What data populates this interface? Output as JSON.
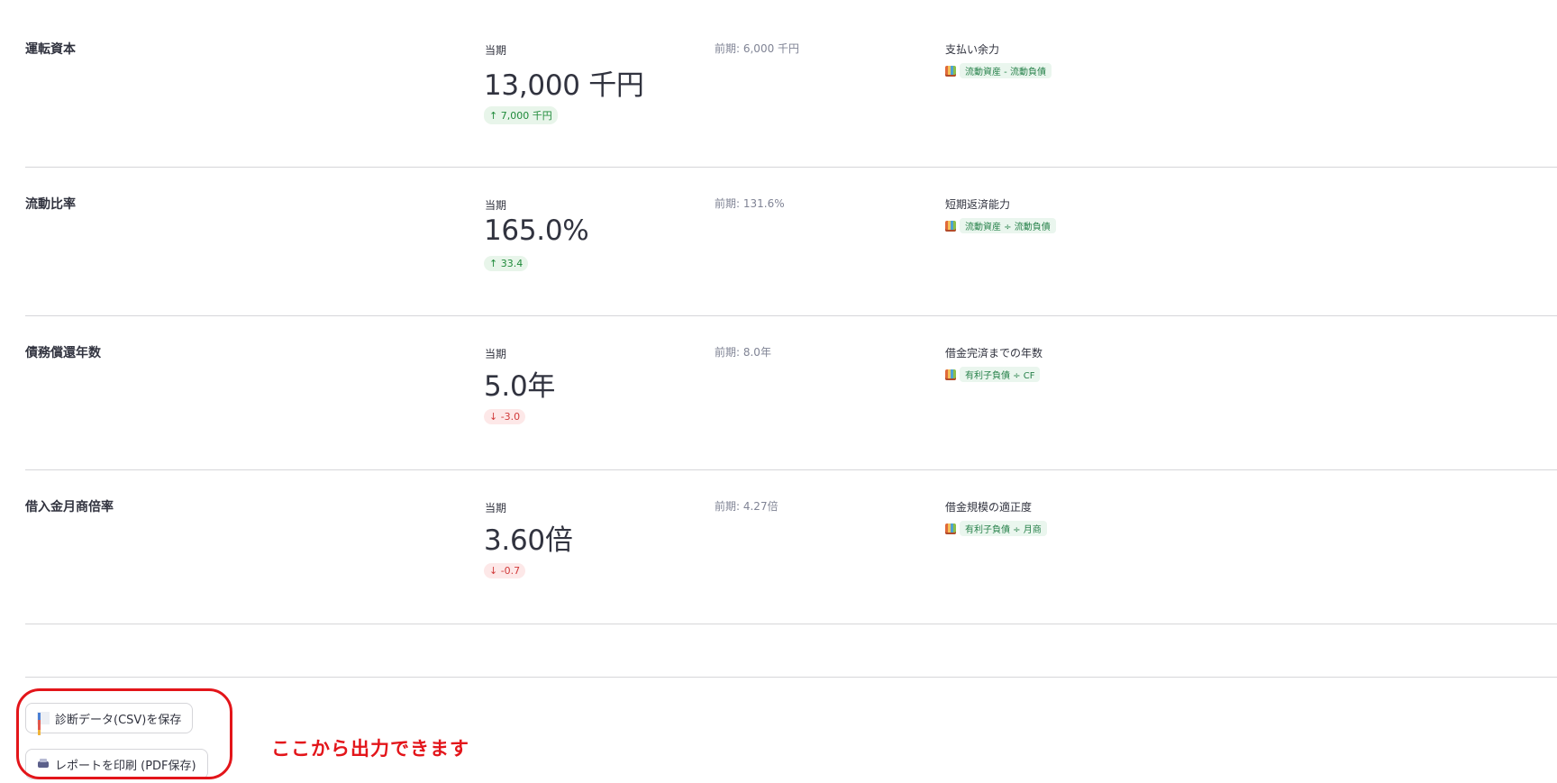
{
  "metrics": [
    {
      "name": "運転資本",
      "current_label": "当期",
      "current_value": "13,000 千円",
      "delta_text": "↑ 7,000 千円",
      "delta_direction": "up",
      "previous": "前期: 6,000 千円",
      "description": "支払い余力",
      "formula": "流動資産 - 流動負債"
    },
    {
      "name": "流動比率",
      "current_label": "当期",
      "current_value": "165.0%",
      "delta_text": "↑ 33.4",
      "delta_direction": "up",
      "previous": "前期: 131.6%",
      "description": "短期返済能力",
      "formula": "流動資産 ÷ 流動負債"
    },
    {
      "name": "債務償還年数",
      "current_label": "当期",
      "current_value": "5.0年",
      "delta_text": "↓ -3.0",
      "delta_direction": "down",
      "previous": "前期: 8.0年",
      "description": "借金完済までの年数",
      "formula": "有利子負債 ÷ CF"
    },
    {
      "name": "借入金月商倍率",
      "current_label": "当期",
      "current_value": "3.60倍",
      "delta_text": "↓ -0.7",
      "delta_direction": "down",
      "previous": "前期: 4.27倍",
      "description": "借金規模の適正度",
      "formula": "有利子負債 ÷ 月商"
    }
  ],
  "buttons": {
    "csv_label": "診断データ(CSV)を保存",
    "pdf_label": "レポートを印刷 (PDF保存)"
  },
  "annotation": "ここから出力できます",
  "colors": {
    "up": "#1f8a3a",
    "down": "#d13b3b",
    "annotation": "#e3151a"
  },
  "icons": {
    "csv": "bar-chart-icon",
    "pdf": "printer-icon",
    "formula": "book-icon"
  }
}
